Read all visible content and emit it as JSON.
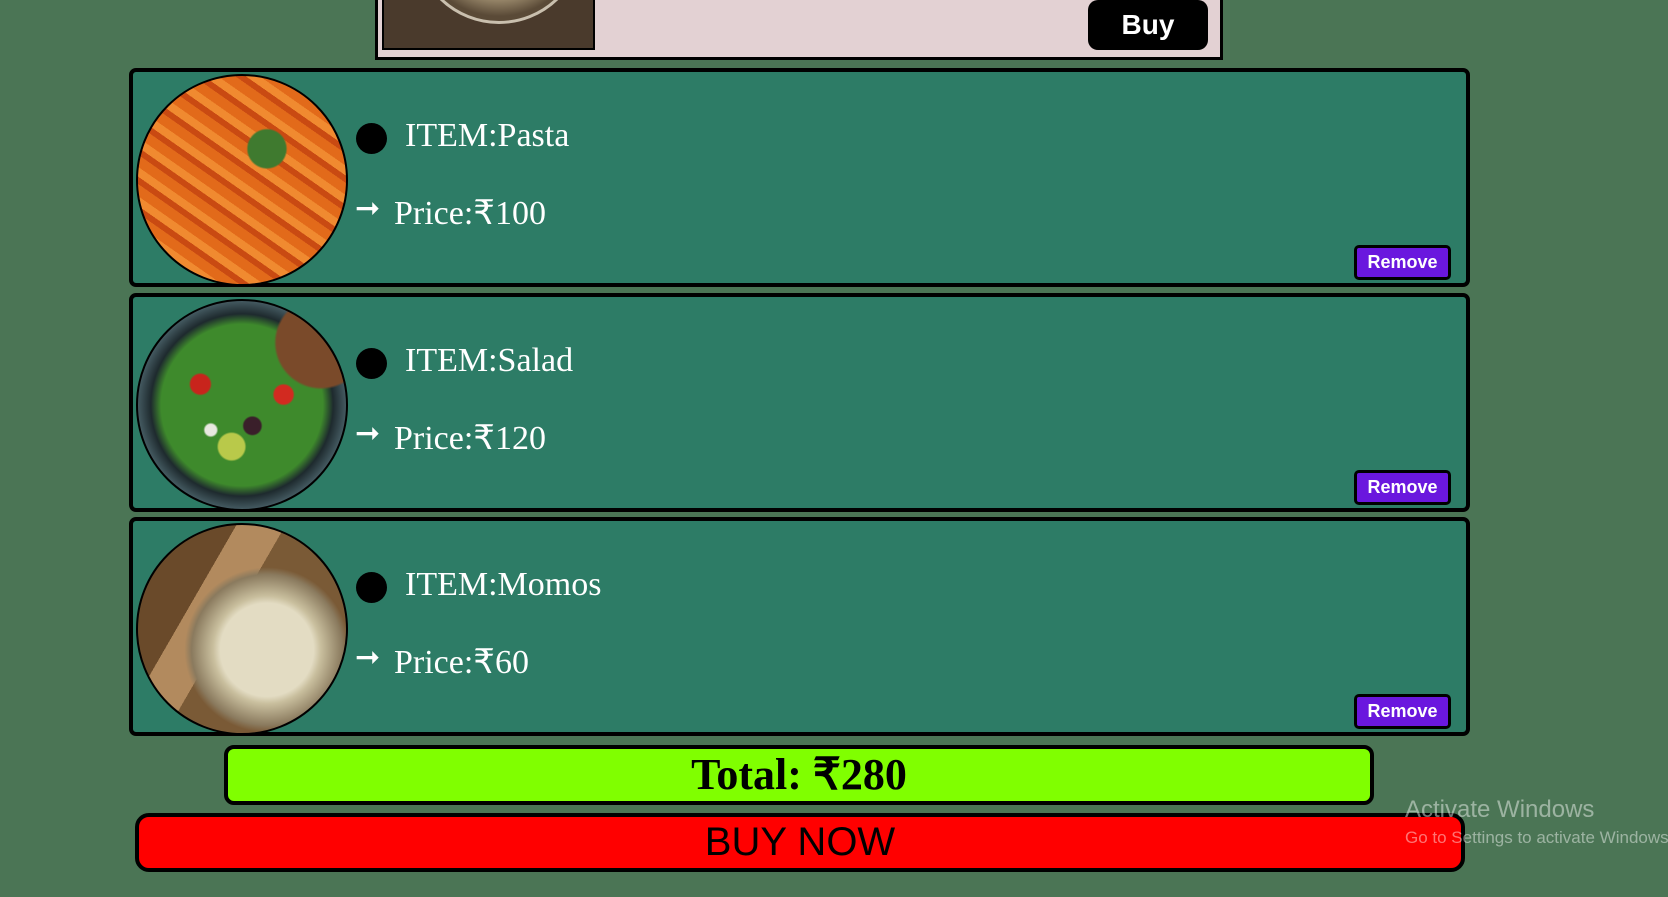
{
  "top_card": {
    "buy_label": "Buy"
  },
  "cart": {
    "items": [
      {
        "image": "pasta-image",
        "name": "ITEM:Pasta",
        "price": "Price:₹100",
        "arrow": "➞",
        "remove_label": "Remove"
      },
      {
        "image": "salad-image",
        "name": "ITEM:Salad",
        "price": "Price:₹120",
        "arrow": "➞",
        "remove_label": "Remove"
      },
      {
        "image": "momos-image",
        "name": "ITEM:Momos",
        "price": "Price:₹60",
        "arrow": "➞",
        "remove_label": "Remove"
      }
    ]
  },
  "total": {
    "label": "Total: ₹280"
  },
  "buy_now": {
    "label": "BUY NOW"
  },
  "watermark": {
    "title": "Activate Windows",
    "subtitle": "Go to Settings to activate Windows."
  },
  "colors": {
    "page_background": "#4b7555",
    "card_background": "#2d7c66",
    "top_card_background": "#e3d1d3",
    "remove_button": "#6a17de",
    "total_bar": "#80ff00",
    "buy_now_button": "#ff0000"
  }
}
